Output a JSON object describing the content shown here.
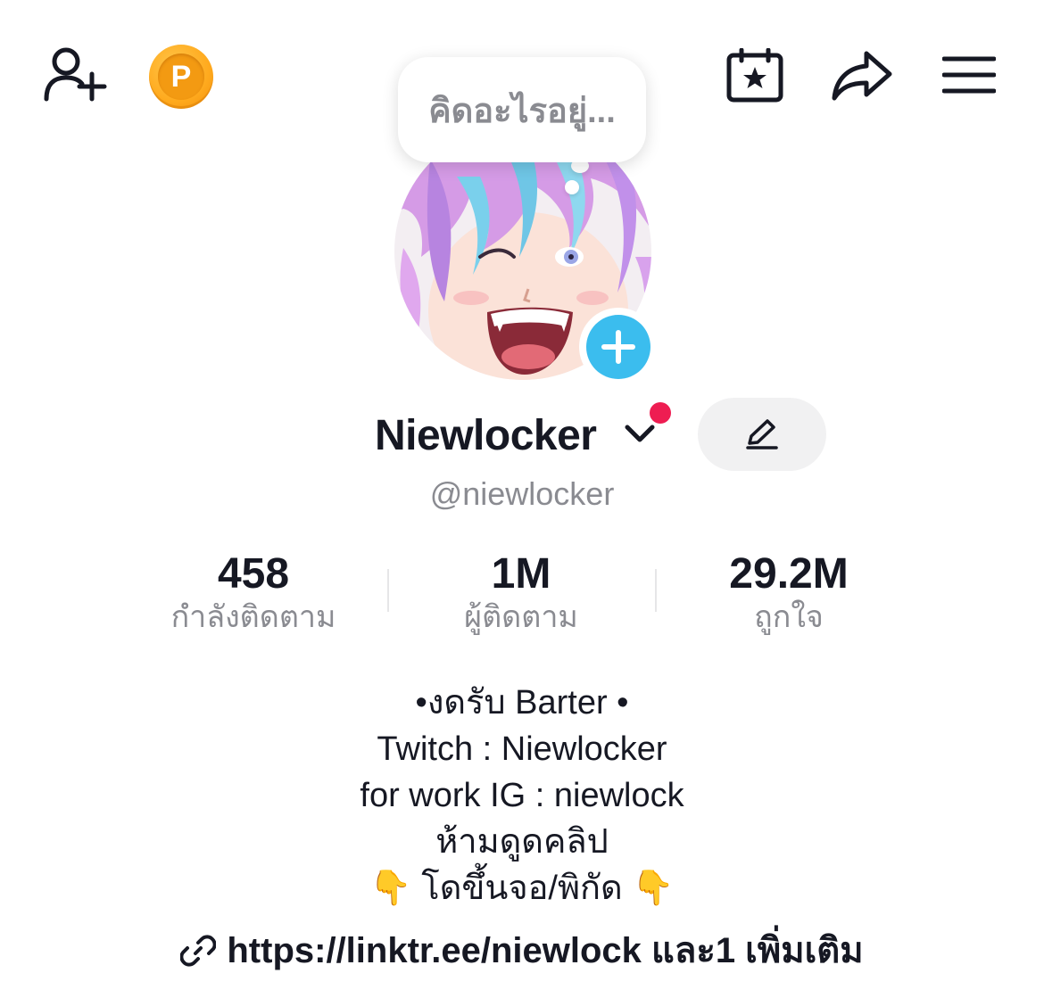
{
  "bubble": {
    "placeholder": "คิดอะไรอยู่..."
  },
  "profile": {
    "name": "Niewlocker",
    "handle": "@niewlocker"
  },
  "stats": [
    {
      "value": "458",
      "label": "กำลังติดตาม"
    },
    {
      "value": "1M",
      "label": "ผู้ติดตาม"
    },
    {
      "value": "29.2M",
      "label": "ถูกใจ"
    }
  ],
  "coin": {
    "letter": "P"
  },
  "bio": {
    "lines": [
      "•งดรับ Barter •",
      "Twitch : Niewlocker",
      "for work IG : niewlock",
      "ห้ามดูดคลิป",
      "👇 โดขึ้นจอ/พิกัด 👇"
    ]
  },
  "link": {
    "text": "https://linktr.ee/niewlock และ1 เพิ่มเติม"
  },
  "colors": {
    "accent_blue": "#3bbdee",
    "notification_red": "#ee1d52",
    "coin_orange": "#f39a12",
    "muted_text": "#8a8b91"
  },
  "icons": {
    "top_left": [
      "add-friend-icon",
      "coin-icon"
    ],
    "top_right": [
      "calendar-star-icon",
      "share-icon",
      "menu-icon"
    ]
  }
}
